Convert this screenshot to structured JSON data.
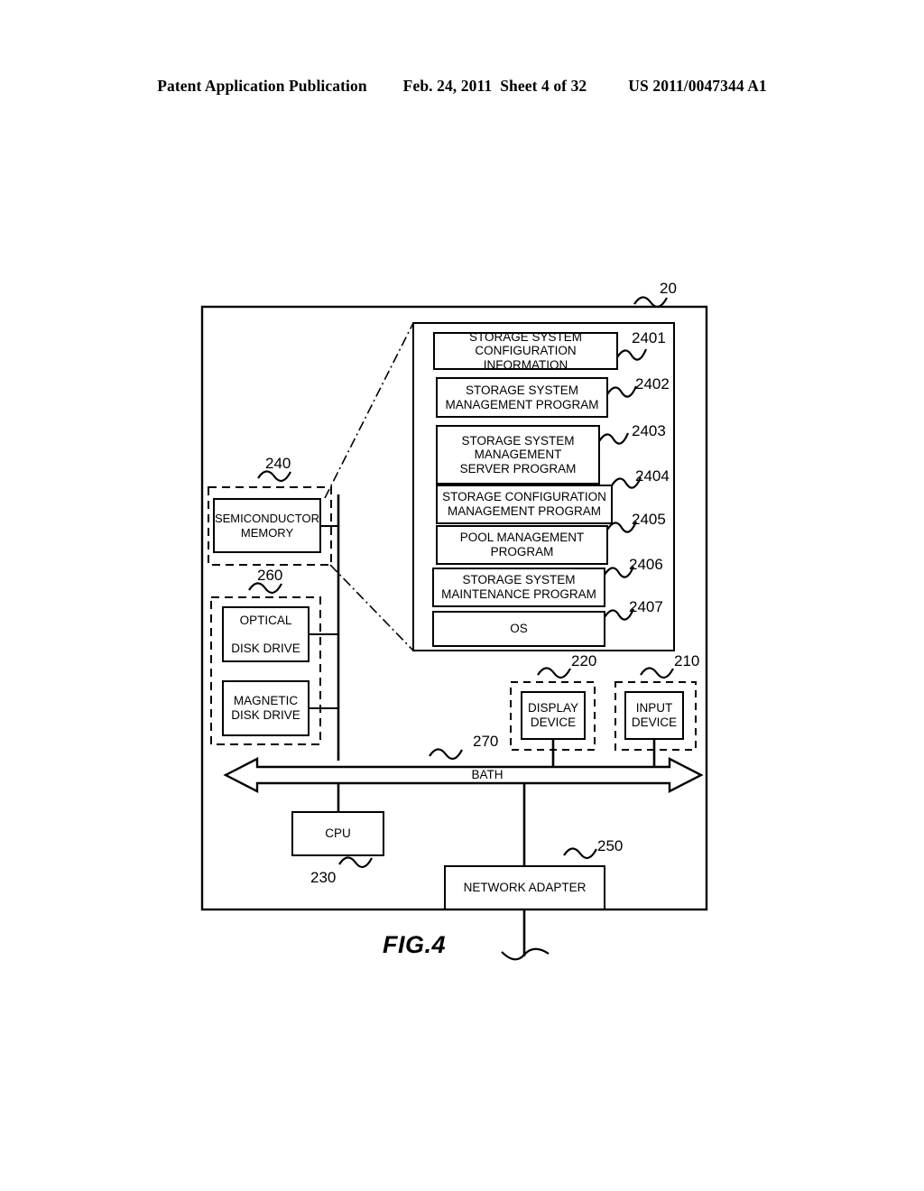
{
  "header": {
    "publication": "Patent Application Publication",
    "date": "Feb. 24, 2011",
    "sheet": "Sheet 4 of 32",
    "patent_number": "US 2011/0047344 A1"
  },
  "figure": {
    "caption": "FIG.4",
    "outer_ref": "20",
    "bus": {
      "label": "BATH",
      "ref": "270"
    },
    "memory_group": {
      "ref": "240",
      "box_label": "SEMICONDUCTOR\nMEMORY"
    },
    "drive_group": {
      "ref": "260",
      "optical_label": "OPTICAL\n\nDISK DRIVE",
      "magnetic_label": "MAGNETIC\nDISK DRIVE"
    },
    "display_group": {
      "ref": "220",
      "box_label": "DISPLAY\nDEVICE"
    },
    "input_group": {
      "ref": "210",
      "box_label": "INPUT\nDEVICE"
    },
    "cpu": {
      "ref": "230",
      "label": "CPU"
    },
    "network_adapter": {
      "ref": "250",
      "label": "NETWORK ADAPTER"
    },
    "memory_detail": {
      "items": [
        {
          "ref": "2401",
          "label": "STORAGE SYSTEM\nCONFIGURATION INFORMATION"
        },
        {
          "ref": "2402",
          "label": "STORAGE SYSTEM\nMANAGEMENT PROGRAM"
        },
        {
          "ref": "2403",
          "label": "STORAGE SYSTEM\nMANAGEMENT\nSERVER PROGRAM"
        },
        {
          "ref": "2404",
          "label": "STORAGE CONFIGURATION\nMANAGEMENT PROGRAM"
        },
        {
          "ref": "2405",
          "label": "POOL MANAGEMENT\nPROGRAM"
        },
        {
          "ref": "2406",
          "label": "STORAGE SYSTEM\nMAINTENANCE PROGRAM"
        },
        {
          "ref": "2407",
          "label": "OS"
        }
      ]
    }
  },
  "colors": {
    "ink": "#000000",
    "paper": "#ffffff"
  }
}
